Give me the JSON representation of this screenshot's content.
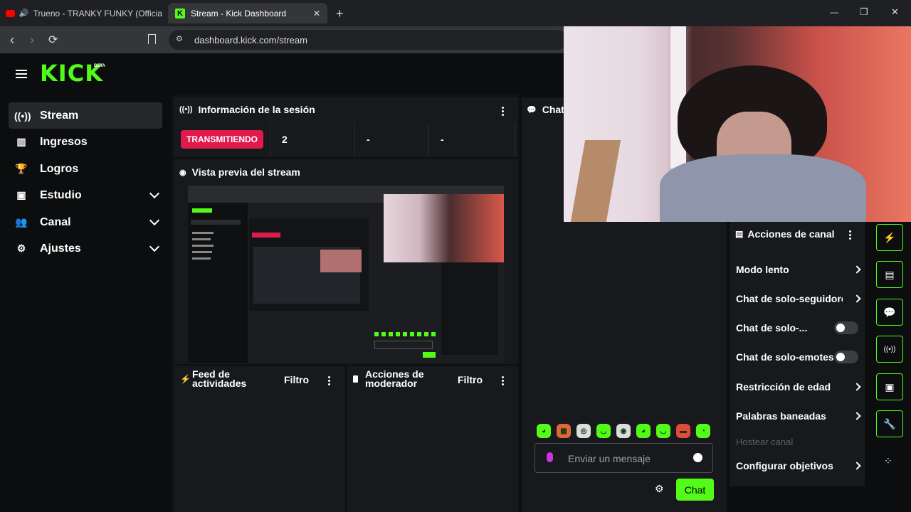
{
  "browser": {
    "tabs": [
      {
        "label": "Trueno - TRANKY FUNKY (Officia",
        "active": false
      },
      {
        "label": "Stream - Kick Dashboard",
        "active": true
      }
    ],
    "url": "dashboard.kick.com/stream"
  },
  "brand": {
    "logo": "KICK",
    "badge": "BETA",
    "accent": "#53fc18"
  },
  "sidebar": {
    "items": [
      {
        "label": "Stream",
        "icon": "broadcast-icon",
        "active": true
      },
      {
        "label": "Ingresos",
        "icon": "chart-icon"
      },
      {
        "label": "Logros",
        "icon": "trophy-icon"
      },
      {
        "label": "Estudio",
        "icon": "studio-icon",
        "expandable": true
      },
      {
        "label": "Canal",
        "icon": "users-icon",
        "expandable": true
      },
      {
        "label": "Ajustes",
        "icon": "gear-icon",
        "expandable": true
      }
    ]
  },
  "session": {
    "title": "Información de la sesión",
    "status": "TRANSMITIENDO",
    "values": [
      "2",
      "-",
      "-"
    ]
  },
  "preview": {
    "title": "Vista previa del stream"
  },
  "chat": {
    "title": "Chat",
    "placeholder": "Enviar un mensaje",
    "send_label": "Chat"
  },
  "activity_feed": {
    "title_line1": "Feed de",
    "title_line2": "actividades",
    "filter": "Filtro"
  },
  "mod_actions": {
    "title_line1": "Acciones de",
    "title_line2": "moderador",
    "filter": "Filtro"
  },
  "channel_actions": {
    "title": "Acciones de canal",
    "items": [
      {
        "label": "Modo lento",
        "control": "chevron"
      },
      {
        "label": "Chat de solo-seguidores",
        "control": "chevron"
      },
      {
        "label": "Chat de solo-...",
        "control": "toggle"
      },
      {
        "label": "Chat de solo-emotes",
        "control": "toggle"
      },
      {
        "label": "Restricción de edad",
        "control": "chevron"
      },
      {
        "label": "Palabras baneadas",
        "control": "chevron"
      },
      {
        "label": "Hostear canal",
        "control": "none",
        "disabled": true
      },
      {
        "label": "Configurar objetivos",
        "control": "chevron"
      }
    ]
  },
  "window_controls": {
    "minimize": "—",
    "restore": "❐",
    "close": "✕"
  }
}
